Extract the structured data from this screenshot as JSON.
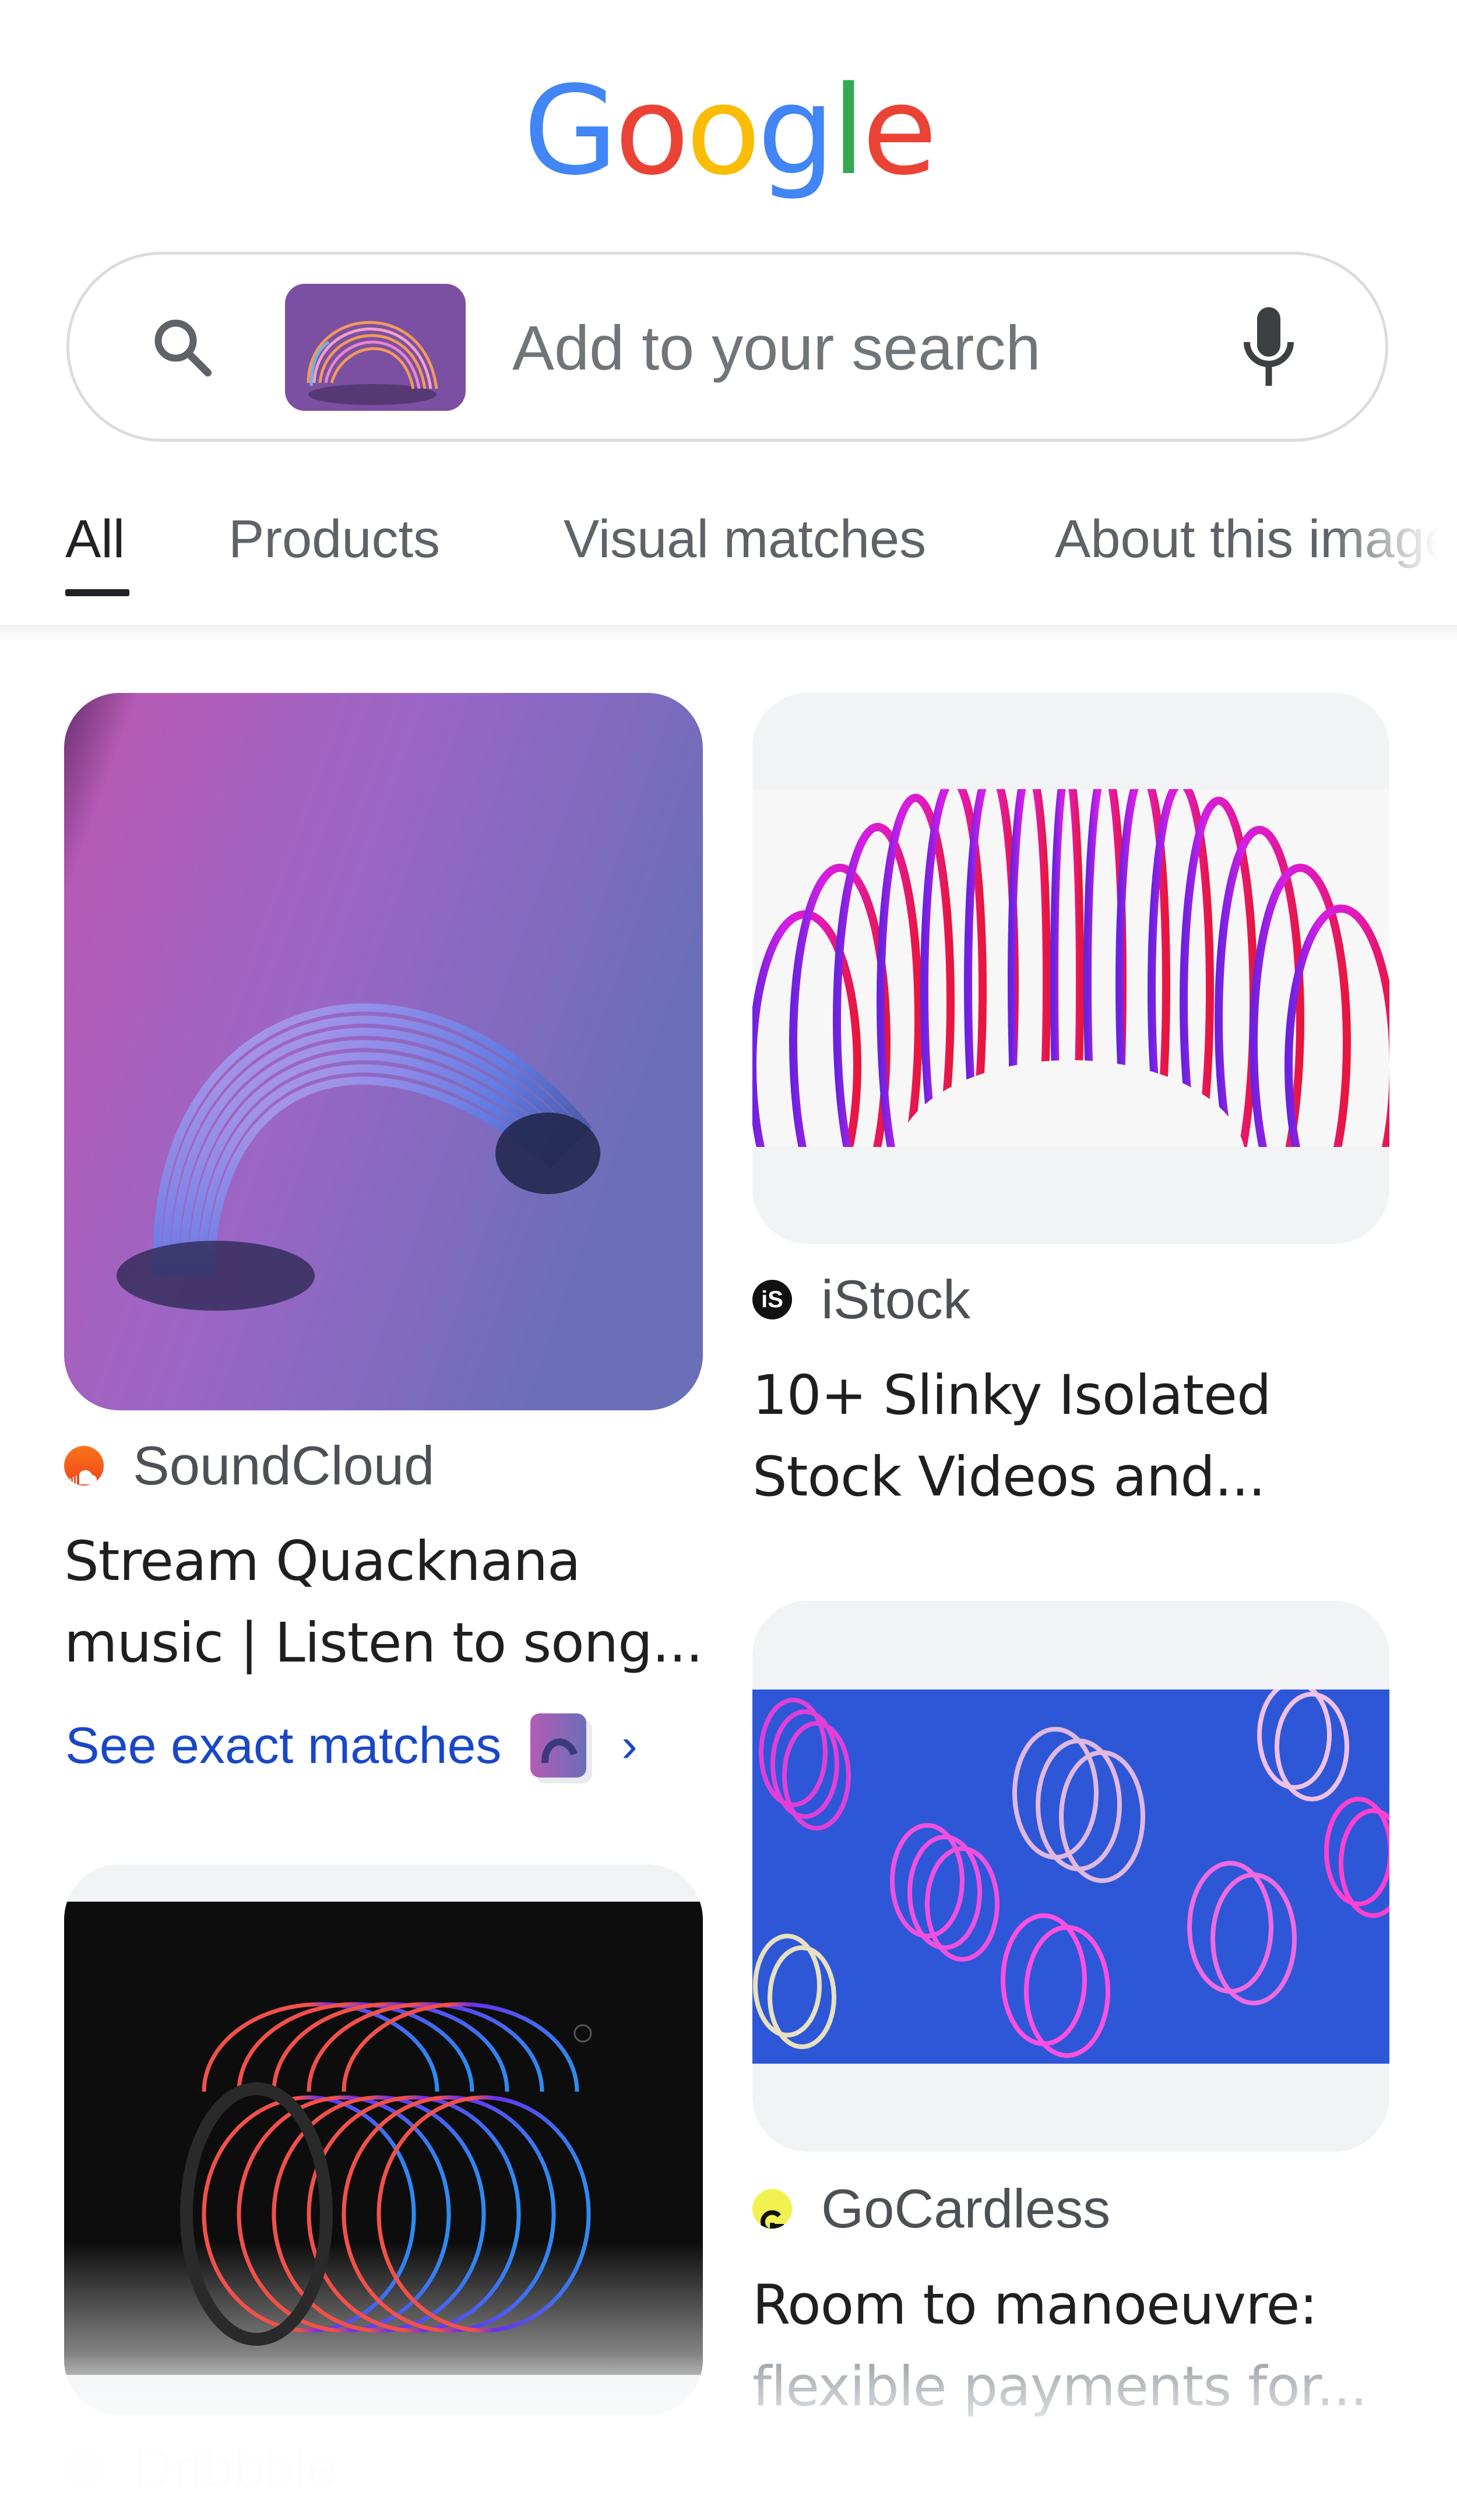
{
  "header": {
    "logo_letters": [
      {
        "char": "G",
        "color": "#4285F4"
      },
      {
        "char": "o",
        "color": "#EA4335"
      },
      {
        "char": "o",
        "color": "#FBBC05"
      },
      {
        "char": "g",
        "color": "#4285F4"
      },
      {
        "char": "l",
        "color": "#34A853"
      },
      {
        "char": "e",
        "color": "#EA4335"
      }
    ]
  },
  "search": {
    "placeholder": "Add to your search",
    "query_image": "slinky-thumbnail",
    "search_icon": "search-icon",
    "mic_icon": "mic-icon"
  },
  "tabs": [
    {
      "label": "All",
      "active": true
    },
    {
      "label": "Products",
      "active": false
    },
    {
      "label": "Visual matches",
      "active": false
    },
    {
      "label": "About this image",
      "active": false
    }
  ],
  "results": [
    {
      "source": "SoundCloud",
      "favicon": "soundcloud-icon",
      "title_line1": "Stream Quacknana",
      "title_line2": "music | Listen to song...",
      "exact_matches_label": "See exact matches",
      "exact_matches_chevron": "›"
    },
    {
      "source": "iStock",
      "favicon": "istock-icon",
      "favicon_text": "iS",
      "title_line1": "10+ Slinky Isolated",
      "title_line2": "Stock Videos and..."
    },
    {
      "source": "GoCardless",
      "favicon": "gocardless-icon",
      "title_line1": "Room to manoeuvre:",
      "title_line2": "flexible payments for..."
    },
    {
      "source": "Dribbble",
      "favicon": "dribbble-icon"
    }
  ],
  "colors": {
    "link_blue": "#1a47c7",
    "tab_active": "#202124",
    "tab_inactive": "#5f6368"
  }
}
